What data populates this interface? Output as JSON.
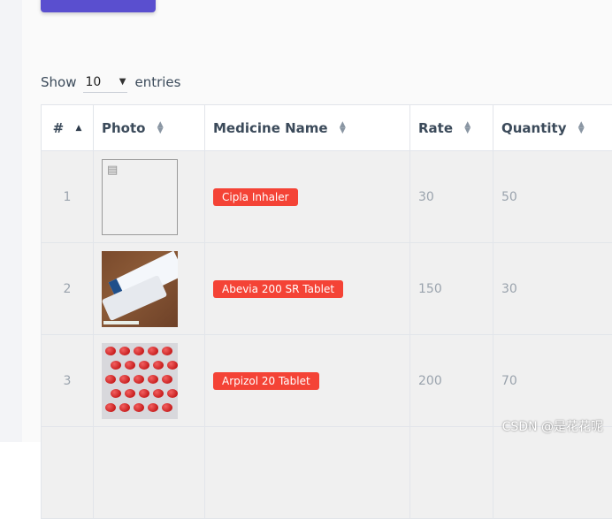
{
  "colors": {
    "accent": "#5a4fcf",
    "badge": "#f44336",
    "row_bg": "#f0f0f0"
  },
  "length": {
    "show_label": "Show",
    "value": "10",
    "entries_label": "entries"
  },
  "table": {
    "headers": [
      "#",
      "Photo",
      "Medicine Name",
      "Rate",
      "Quantity"
    ],
    "rows": [
      {
        "num": "1",
        "photo": "broken-image-icon",
        "name": "Cipla Inhaler",
        "rate": "30",
        "quantity": "50"
      },
      {
        "num": "2",
        "photo": "medicine-box-photo",
        "name": "Abevia 200 SR Tablet",
        "rate": "150",
        "quantity": "30"
      },
      {
        "num": "3",
        "photo": "red-pills-blister-photo",
        "name": "Arpizol 20 Tablet",
        "rate": "200",
        "quantity": "70"
      }
    ]
  },
  "watermark": "CSDN @是花花呢"
}
